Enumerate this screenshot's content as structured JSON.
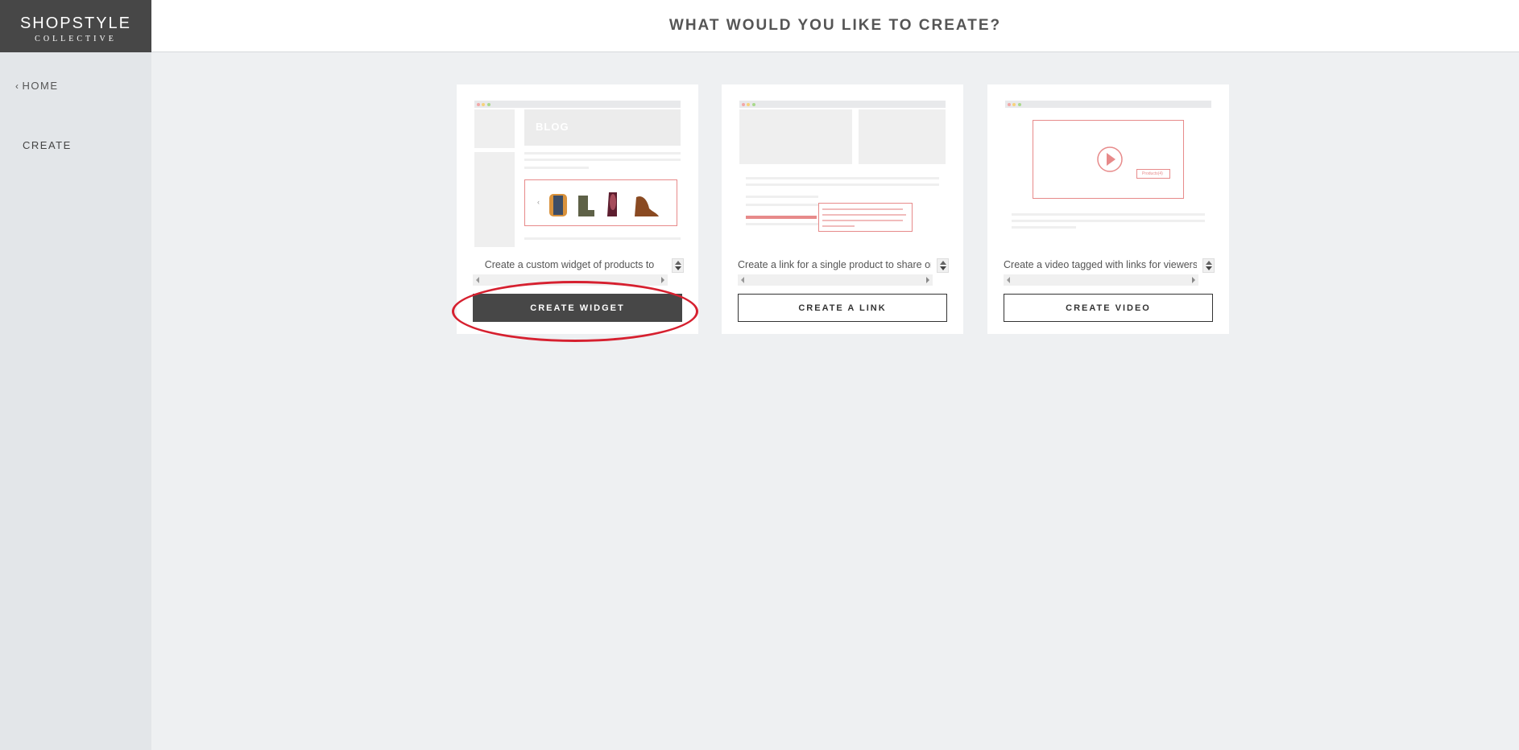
{
  "logo": {
    "brand": "SHOPSTYLE",
    "sub": "COLLECTIVE"
  },
  "sidebar": {
    "home_label": "HOME",
    "create_label": "CREATE"
  },
  "header": {
    "title": "WHAT WOULD YOU LIKE TO CREATE?"
  },
  "cards": [
    {
      "preview_label": "BLOG",
      "description": "Create a custom widget of products to",
      "button_label": "CREATE WIDGET"
    },
    {
      "description": "Create a link for a single product to share on",
      "button_label": "CREATE A LINK"
    },
    {
      "preview_tag": "Products(4)",
      "description": "Create a video tagged with links for viewers",
      "button_label": "CREATE VIDEO"
    }
  ],
  "colors": {
    "accent_red": "#e78a8a",
    "highlight_red": "#d6202f",
    "dark_button": "#474747",
    "sidebar_bg": "#e3e6e9"
  }
}
